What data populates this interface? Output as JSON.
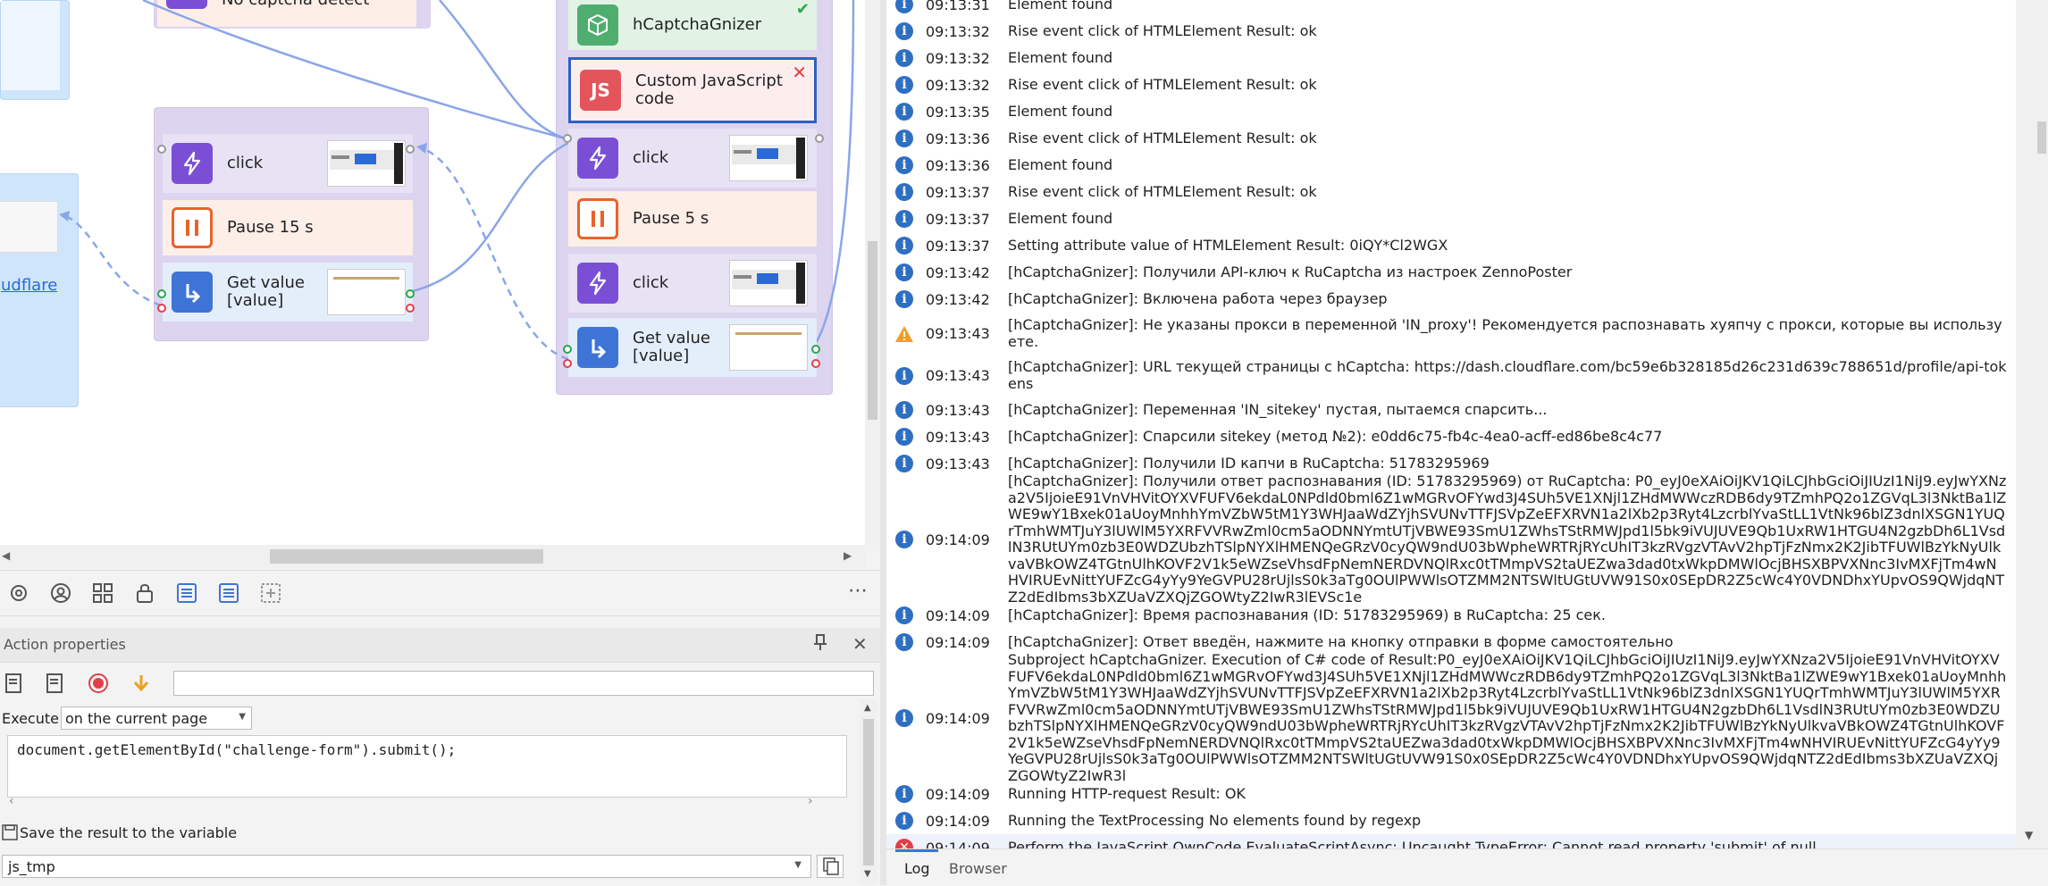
{
  "canvas": {
    "nodes": {
      "top_left_partial": "No captcha detect",
      "hcaptcha": "hCaptchaGnizer",
      "custom_js": "Custom JavaScript code",
      "click_a": "click",
      "pause_15": "Pause 15 s",
      "get_value_a": "Get value [value]",
      "click_b": "click",
      "pause_5": "Pause 5 s",
      "click_c": "click",
      "get_value_b": "Get value [value]",
      "link_partial": "udflare"
    },
    "colors": {
      "purple_group": "#ddd4ef",
      "blue_group": "#cfe5fb",
      "action_icon": "#7a4fd6",
      "pause_icon": "#e8632a",
      "get_icon": "#3e74d6",
      "js_icon": "#e3545b",
      "gnizer_icon": "#4fae6f"
    }
  },
  "toolbar": {
    "icons": [
      "gear-icon",
      "user-circle-icon",
      "grid-icon",
      "lock-icon",
      "list-icon",
      "list-alt-icon",
      "expand-icon",
      "more-icon"
    ]
  },
  "props": {
    "title": "Action properties",
    "execute_label": "Execute",
    "execute_value": "on the current page",
    "code": "document.getElementById(\"challenge-form\").submit();",
    "save_label": "Save the result to the variable",
    "variable_value": "js_tmp",
    "filter_placeholder": ""
  },
  "log": {
    "rows": [
      {
        "type": "info",
        "time": "09:13:31",
        "msg": "Element found"
      },
      {
        "type": "info",
        "time": "09:13:32",
        "msg": "Rise event click of HTMLElement  Result: ok"
      },
      {
        "type": "info",
        "time": "09:13:32",
        "msg": "Element found"
      },
      {
        "type": "info",
        "time": "09:13:32",
        "msg": "Rise event click of HTMLElement  Result: ok"
      },
      {
        "type": "info",
        "time": "09:13:35",
        "msg": "Element found"
      },
      {
        "type": "info",
        "time": "09:13:36",
        "msg": "Rise event click of HTMLElement  Result: ok"
      },
      {
        "type": "info",
        "time": "09:13:36",
        "msg": "Element found"
      },
      {
        "type": "info",
        "time": "09:13:37",
        "msg": "Rise event click of HTMLElement  Result: ok"
      },
      {
        "type": "info",
        "time": "09:13:37",
        "msg": "Element found"
      },
      {
        "type": "info",
        "time": "09:13:37",
        "msg": "Setting attribute value of HTMLElement  Result: 0iQY*Cl2WGX"
      },
      {
        "type": "info",
        "time": "09:13:42",
        "msg": "[hCaptchaGnizer]: Получили API-ключ к RuCaptcha из настроек ZennoPoster"
      },
      {
        "type": "info",
        "time": "09:13:42",
        "msg": "[hCaptchaGnizer]: Включена работа через браузер"
      },
      {
        "type": "warn",
        "time": "09:13:43",
        "msg": "[hCaptchaGnizer]: Не указаны прокси в переменной 'IN_proxy'! Рекомендуется распознавать хуяпчу с прокси, которые вы используете."
      },
      {
        "type": "info",
        "time": "09:13:43",
        "msg": "[hCaptchaGnizer]: URL текущей страницы с hCaptcha: https://dash.cloudflare.com/bc59e6b328185d26c231d639c788651d/profile/api-tokens"
      },
      {
        "type": "info",
        "time": "09:13:43",
        "msg": "[hCaptchaGnizer]: Переменная 'IN_sitekey' пустая, пытаемся спарсить..."
      },
      {
        "type": "info",
        "time": "09:13:43",
        "msg": "[hCaptchaGnizer]: Спарсили sitekey (метод №2): e0dd6c75-fb4c-4ea0-acff-ed86be8c4c77"
      },
      {
        "type": "info",
        "time": "09:13:43",
        "msg": "[hCaptchaGnizer]: Получили ID капчи в RuCaptcha: 51783295969"
      },
      {
        "type": "info",
        "time": "09:14:09",
        "msg": "[hCaptchaGnizer]: Получили ответ распознавания (ID: 51783295969) от RuCaptcha: P0_eyJ0eXAiOiJKV1QiLCJhbGciOiJIUzI1NiJ9.eyJwYXNza2V5IjoieE91VnVHVitOYXVFUFV6ekdaL0NPdld0bml6Z1wMGRvOFYwd3J4SUh5VE1XNjl1ZHdMWWczRDB6dy9TZmhPQ2o1ZGVqL3l3NktBa1lZWE9wY1Bxek01aUoyMnhhYmVZbW5tM1Y3WHJaaWdZYjhSVUNvTTFJSVpZeEFXRVN1a2lXb2p3Ryt4LzcrblYvaStLL1VtNk96blZ3dnlXSGN1YUQrTmhWMTJuY3lUWlM5YXRFVVRwZml0cm5aODNNYmtUTjVBWE93SmU1ZWhsTStRMWJpd1l5bk9iVUJUVE9Qb1UxRW1HTGU4N2gzbDh6L1VsdlN3RUtUYm0zb3E0WDZUbzhTSlpNYXlHMENQeGRzV0cyQW9ndU03bWpheWRTRjRYcUhIT3kzRVgzVTAvV2hpTjFzNmx2K2JibTFUWlBzYkNyUlkvaVBkOWZ4TGtnUlhKOVF2V1k5eWZseVhsdFpNemNERDVNQlRxc0tTMmpVS2taUEZwa3dad0txWkpDMWlOcjBHSXBPVXNnc3IvMXFjTm4wNHVIRUEvNittYUFZcG4yYy9YeGVPU28rUjlsS0k3aTg0OUlPWWlsOTZMM2NTSWltUGtUVW91S0x0SEpDR2Z5cWc4Y0VDNDhxYUpvOS9QWjdqNTZ2dEdIbms3bXZUaVZXQjZGOWtyZ2IwR3lEVSc1e"
      },
      {
        "type": "info",
        "time": "09:14:09",
        "msg": "[hCaptchaGnizer]: Время распознавания (ID: 51783295969) в RuCaptcha: 25 сек."
      },
      {
        "type": "info",
        "time": "09:14:09",
        "msg": "[hCaptchaGnizer]: Ответ введён, нажмите на кнопку отправки в форме самостоятельно"
      },
      {
        "type": "info",
        "time": "09:14:09",
        "msg": "Subproject hCaptchaGnizer. Execution of C# code of Result:P0_eyJ0eXAiOiJKV1QiLCJhbGciOiJIUzI1NiJ9.eyJwYXNza2V5IjoieE91VnVHVitOYXVFUFV6ekdaL0NPdld0bml6Z1wMGRvOFYwd3J4SUh5VE1XNjl1ZHdMWWczRDB6dy9TZmhPQ2o1ZGVqL3l3NktBa1lZWE9wY1Bxek01aUoyMnhhYmVZbW5tM1Y3WHJaaWdZYjhSVUNvTTFJSVpZeEFXRVN1a2lXb2p3Ryt4LzcrblYvaStLL1VtNk96blZ3dnlXSGN1YUQrTmhWMTJuY3lUWlM5YXRFVVRwZml0cm5aODNNYmtUTjVBWE93SmU1ZWhsTStRMWJpd1l5bk9iVUJUVE9Qb1UxRW1HTGU4N2gzbDh6L1VsdlN3RUtUYm0zb3E0WDZUbzhTSlpNYXlHMENQeGRzV0cyQW9ndU03bWpheWRTRjRYcUhIT3kzRVgzVTAvV2hpTjFzNmx2K2JibTFUWlBzYkNyUlkvaVBkOWZ4TGtnUlhKOVF2V1k5eWZseVhsdFpNemNERDVNQlRxc0tTMmpVS2taUEZwa3dad0txWkpDMWlOcjBHSXBPVXNnc3IvMXFjTm4wNHVIRUEvNittYUFZcG4yYy9YeGVPU28rUjlsS0k3aTg0OUlPWWlsOTZMM2NTSWltUGtUVW91S0x0SEpDR2Z5cWc4Y0VDNDhxYUpvOS9QWjdqNTZ2dEdIbms3bXZUaVZXQjZGOWtyZ2IwR3l"
      },
      {
        "type": "info",
        "time": "09:14:09",
        "msg": "Running HTTP-request  Result: OK"
      },
      {
        "type": "info",
        "time": "09:14:09",
        "msg": "Running the TextProcessing  No elements found by regexp"
      },
      {
        "type": "error",
        "time": "09:14:09",
        "msg": "Perform the JavaScript OwnCode  EvaluateScriptAsync: Uncaught TypeError: Cannot read property 'submit' of null"
      }
    ]
  },
  "log_tabs": {
    "log": "Log",
    "browser": "Browser"
  }
}
